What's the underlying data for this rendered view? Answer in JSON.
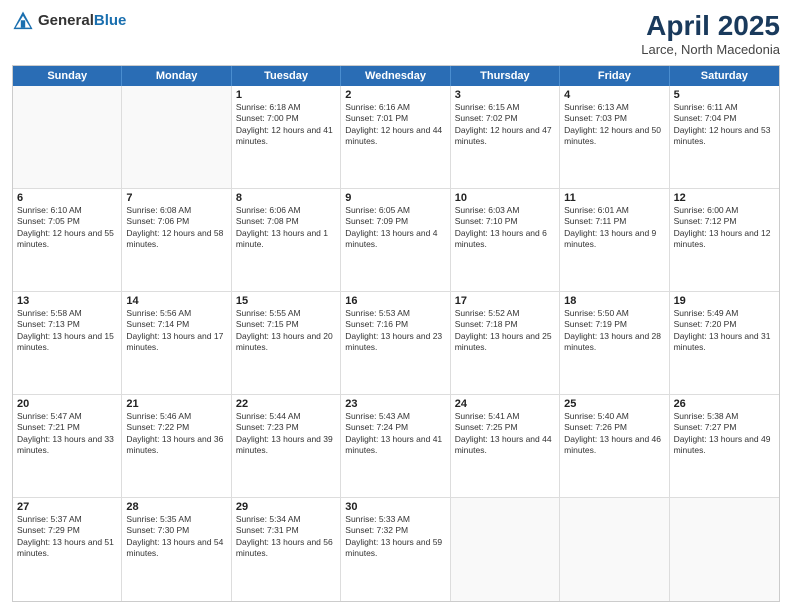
{
  "header": {
    "logo_general": "General",
    "logo_blue": "Blue",
    "title": "April 2025",
    "location": "Larce, North Macedonia"
  },
  "day_headers": [
    "Sunday",
    "Monday",
    "Tuesday",
    "Wednesday",
    "Thursday",
    "Friday",
    "Saturday"
  ],
  "weeks": [
    [
      {
        "date": "",
        "info": ""
      },
      {
        "date": "",
        "info": ""
      },
      {
        "date": "1",
        "info": "Sunrise: 6:18 AM\nSunset: 7:00 PM\nDaylight: 12 hours and 41 minutes."
      },
      {
        "date": "2",
        "info": "Sunrise: 6:16 AM\nSunset: 7:01 PM\nDaylight: 12 hours and 44 minutes."
      },
      {
        "date": "3",
        "info": "Sunrise: 6:15 AM\nSunset: 7:02 PM\nDaylight: 12 hours and 47 minutes."
      },
      {
        "date": "4",
        "info": "Sunrise: 6:13 AM\nSunset: 7:03 PM\nDaylight: 12 hours and 50 minutes."
      },
      {
        "date": "5",
        "info": "Sunrise: 6:11 AM\nSunset: 7:04 PM\nDaylight: 12 hours and 53 minutes."
      }
    ],
    [
      {
        "date": "6",
        "info": "Sunrise: 6:10 AM\nSunset: 7:05 PM\nDaylight: 12 hours and 55 minutes."
      },
      {
        "date": "7",
        "info": "Sunrise: 6:08 AM\nSunset: 7:06 PM\nDaylight: 12 hours and 58 minutes."
      },
      {
        "date": "8",
        "info": "Sunrise: 6:06 AM\nSunset: 7:08 PM\nDaylight: 13 hours and 1 minute."
      },
      {
        "date": "9",
        "info": "Sunrise: 6:05 AM\nSunset: 7:09 PM\nDaylight: 13 hours and 4 minutes."
      },
      {
        "date": "10",
        "info": "Sunrise: 6:03 AM\nSunset: 7:10 PM\nDaylight: 13 hours and 6 minutes."
      },
      {
        "date": "11",
        "info": "Sunrise: 6:01 AM\nSunset: 7:11 PM\nDaylight: 13 hours and 9 minutes."
      },
      {
        "date": "12",
        "info": "Sunrise: 6:00 AM\nSunset: 7:12 PM\nDaylight: 13 hours and 12 minutes."
      }
    ],
    [
      {
        "date": "13",
        "info": "Sunrise: 5:58 AM\nSunset: 7:13 PM\nDaylight: 13 hours and 15 minutes."
      },
      {
        "date": "14",
        "info": "Sunrise: 5:56 AM\nSunset: 7:14 PM\nDaylight: 13 hours and 17 minutes."
      },
      {
        "date": "15",
        "info": "Sunrise: 5:55 AM\nSunset: 7:15 PM\nDaylight: 13 hours and 20 minutes."
      },
      {
        "date": "16",
        "info": "Sunrise: 5:53 AM\nSunset: 7:16 PM\nDaylight: 13 hours and 23 minutes."
      },
      {
        "date": "17",
        "info": "Sunrise: 5:52 AM\nSunset: 7:18 PM\nDaylight: 13 hours and 25 minutes."
      },
      {
        "date": "18",
        "info": "Sunrise: 5:50 AM\nSunset: 7:19 PM\nDaylight: 13 hours and 28 minutes."
      },
      {
        "date": "19",
        "info": "Sunrise: 5:49 AM\nSunset: 7:20 PM\nDaylight: 13 hours and 31 minutes."
      }
    ],
    [
      {
        "date": "20",
        "info": "Sunrise: 5:47 AM\nSunset: 7:21 PM\nDaylight: 13 hours and 33 minutes."
      },
      {
        "date": "21",
        "info": "Sunrise: 5:46 AM\nSunset: 7:22 PM\nDaylight: 13 hours and 36 minutes."
      },
      {
        "date": "22",
        "info": "Sunrise: 5:44 AM\nSunset: 7:23 PM\nDaylight: 13 hours and 39 minutes."
      },
      {
        "date": "23",
        "info": "Sunrise: 5:43 AM\nSunset: 7:24 PM\nDaylight: 13 hours and 41 minutes."
      },
      {
        "date": "24",
        "info": "Sunrise: 5:41 AM\nSunset: 7:25 PM\nDaylight: 13 hours and 44 minutes."
      },
      {
        "date": "25",
        "info": "Sunrise: 5:40 AM\nSunset: 7:26 PM\nDaylight: 13 hours and 46 minutes."
      },
      {
        "date": "26",
        "info": "Sunrise: 5:38 AM\nSunset: 7:27 PM\nDaylight: 13 hours and 49 minutes."
      }
    ],
    [
      {
        "date": "27",
        "info": "Sunrise: 5:37 AM\nSunset: 7:29 PM\nDaylight: 13 hours and 51 minutes."
      },
      {
        "date": "28",
        "info": "Sunrise: 5:35 AM\nSunset: 7:30 PM\nDaylight: 13 hours and 54 minutes."
      },
      {
        "date": "29",
        "info": "Sunrise: 5:34 AM\nSunset: 7:31 PM\nDaylight: 13 hours and 56 minutes."
      },
      {
        "date": "30",
        "info": "Sunrise: 5:33 AM\nSunset: 7:32 PM\nDaylight: 13 hours and 59 minutes."
      },
      {
        "date": "",
        "info": ""
      },
      {
        "date": "",
        "info": ""
      },
      {
        "date": "",
        "info": ""
      }
    ]
  ]
}
